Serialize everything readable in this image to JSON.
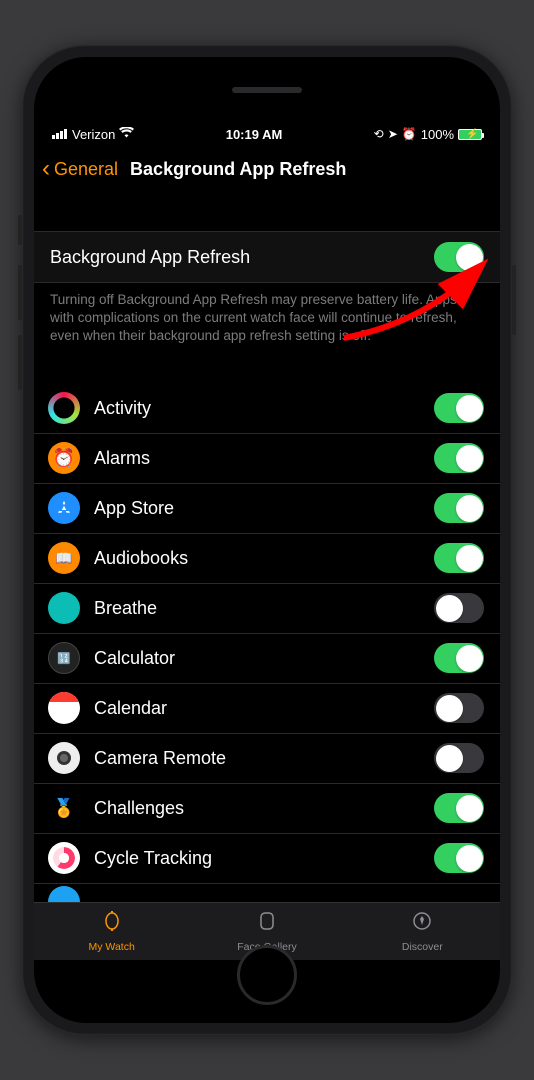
{
  "status": {
    "carrier": "Verizon",
    "time": "10:19 AM",
    "battery_pct": "100%"
  },
  "nav": {
    "back_label": "General",
    "title": "Background App Refresh"
  },
  "master": {
    "label": "Background App Refresh",
    "enabled": true
  },
  "footer": "Turning off Background App Refresh may preserve battery life. Apps with complications on the current watch face will continue to refresh, even when their background app refresh setting is off.",
  "apps": [
    {
      "name": "Activity",
      "icon": "activity",
      "enabled": true
    },
    {
      "name": "Alarms",
      "icon": "alarms",
      "enabled": true
    },
    {
      "name": "App Store",
      "icon": "appstore",
      "enabled": true
    },
    {
      "name": "Audiobooks",
      "icon": "audiobooks",
      "enabled": true
    },
    {
      "name": "Breathe",
      "icon": "breathe",
      "enabled": false
    },
    {
      "name": "Calculator",
      "icon": "calculator",
      "enabled": true
    },
    {
      "name": "Calendar",
      "icon": "calendar",
      "enabled": false
    },
    {
      "name": "Camera Remote",
      "icon": "camera",
      "enabled": false
    },
    {
      "name": "Challenges",
      "icon": "challenges",
      "enabled": true
    },
    {
      "name": "Cycle Tracking",
      "icon": "cycle",
      "enabled": true
    }
  ],
  "tabs": [
    {
      "label": "My Watch",
      "icon": "watch-icon",
      "active": true
    },
    {
      "label": "Face Gallery",
      "icon": "gallery-icon",
      "active": false
    },
    {
      "label": "Discover",
      "icon": "discover-icon",
      "active": false
    }
  ]
}
